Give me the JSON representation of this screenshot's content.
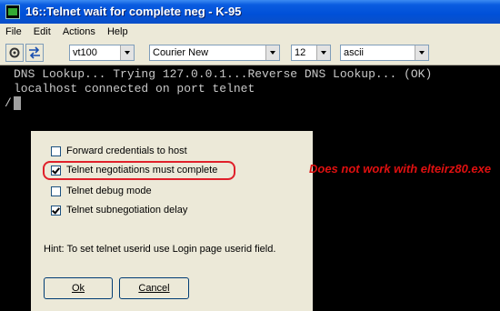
{
  "window": {
    "title": "16::Telnet wait for complete neg - K-95"
  },
  "menu": [
    "File",
    "Edit",
    "Actions",
    "Help"
  ],
  "toolbar": {
    "buttons": [
      "settings-icon",
      "swap-icon"
    ],
    "terminal_type": "vt100",
    "font": "Courier New",
    "font_size": "12",
    "charset": "ascii"
  },
  "terminal": {
    "lines": [
      "DNS Lookup... Trying 127.0.0.1...Reverse DNS Lookup... (OK)",
      "localhost connected on port telnet"
    ],
    "prompt": "/"
  },
  "dialog": {
    "options": [
      {
        "label": "Forward credentials to host",
        "checked": false
      },
      {
        "label": "Telnet negotiations must complete",
        "checked": true
      },
      {
        "label": "Telnet debug mode",
        "checked": false
      },
      {
        "label": "Telnet subnegotiation delay",
        "checked": true
      }
    ],
    "hint": "Hint: To set telnet userid use Login page userid field.",
    "ok_label": "Ok",
    "cancel_label": "Cancel"
  },
  "annotation": "Does not work with elteirz80.exe",
  "colors": {
    "annotation": "#e01010",
    "highlight": "#e0202a"
  }
}
